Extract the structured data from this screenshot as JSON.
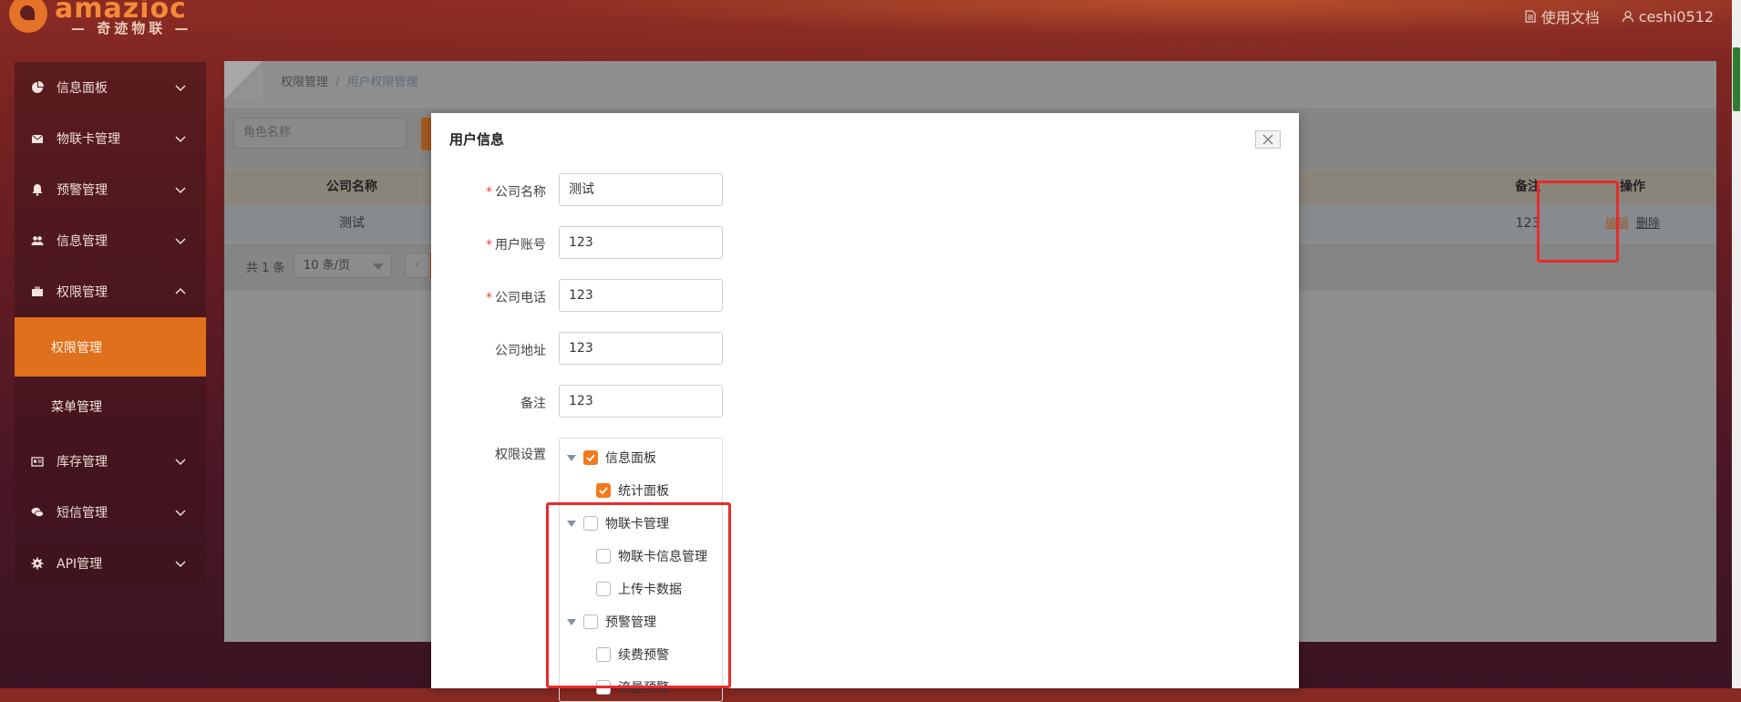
{
  "brand": {
    "name": "amazioc",
    "subtitle": "— 奇迹物联 —"
  },
  "topbar": {
    "docs_label": "使用文档",
    "user_label": "ceshi0512"
  },
  "sidebar": {
    "items": [
      {
        "label": "信息面板",
        "icon": "pie-chart-icon"
      },
      {
        "label": "物联卡管理",
        "icon": "envelope-icon"
      },
      {
        "label": "预警管理",
        "icon": "bell-icon"
      },
      {
        "label": "信息管理",
        "icon": "users-icon"
      },
      {
        "label": "权限管理",
        "icon": "briefcase-icon",
        "expanded": true
      }
    ],
    "sub_items": [
      {
        "label": "权限管理",
        "active": true
      },
      {
        "label": "菜单管理",
        "active": false
      }
    ],
    "items_after": [
      {
        "label": "库存管理",
        "icon": "id-card-icon"
      },
      {
        "label": "短信管理",
        "icon": "chat-icon"
      },
      {
        "label": "API管理",
        "icon": "gear-icon"
      }
    ]
  },
  "breadcrumb": {
    "root": "权限管理",
    "separator": "/",
    "current": "用户权限管理"
  },
  "search": {
    "placeholder": "角色名称"
  },
  "table": {
    "headers": {
      "company": "公司名称",
      "remark": "备注",
      "operation": "操作"
    },
    "rows": [
      {
        "company": "测试",
        "remark": "123",
        "edit": "编辑",
        "delete": "删除"
      }
    ]
  },
  "pager": {
    "total": "共 1 条",
    "page_size": "10 条/页",
    "prev": "‹"
  },
  "modal": {
    "title": "用户信息",
    "fields": [
      {
        "label": "公司名称",
        "value": "测试",
        "required": "*"
      },
      {
        "label": "用户账号",
        "value": "123",
        "required": "*"
      },
      {
        "label": "公司电话",
        "value": "123",
        "required": "*"
      },
      {
        "label": "公司地址",
        "value": "123",
        "required": ""
      },
      {
        "label": "备注",
        "value": "123",
        "required": ""
      }
    ],
    "permission_label": "权限设置",
    "tree": [
      {
        "label": "信息面板",
        "checked": true,
        "level": 0
      },
      {
        "label": "统计面板",
        "checked": true,
        "level": 1
      },
      {
        "label": "物联卡管理",
        "checked": false,
        "level": 0
      },
      {
        "label": "物联卡信息管理",
        "checked": false,
        "level": 1
      },
      {
        "label": "上传卡数据",
        "checked": false,
        "level": 1
      },
      {
        "label": "预警管理",
        "checked": false,
        "level": 0
      },
      {
        "label": "续费预警",
        "checked": false,
        "level": 1
      },
      {
        "label": "流量预警",
        "checked": false,
        "level": 1
      }
    ]
  },
  "colors": {
    "accent": "#f27a1c",
    "highlight": "#ea2a2a"
  }
}
